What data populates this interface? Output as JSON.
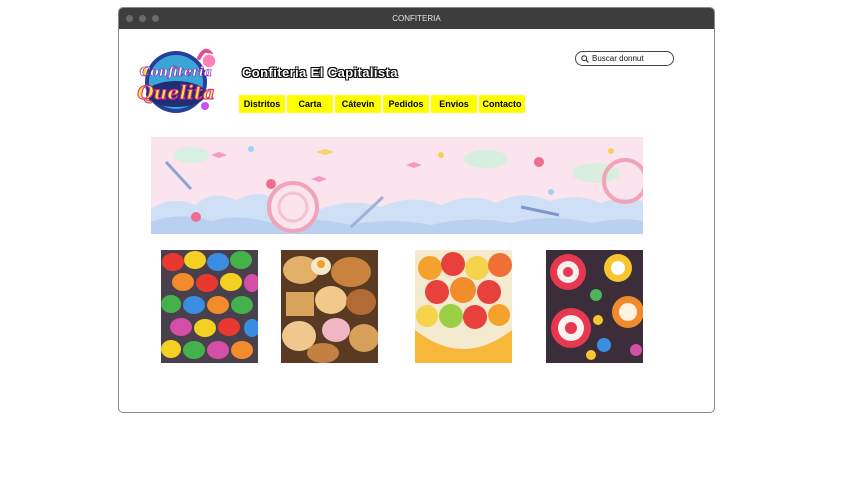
{
  "window": {
    "title": "CONFITERIA"
  },
  "logo": {
    "line1": "Confiteria",
    "line2": "Quelita"
  },
  "header": {
    "title": "Confiteria  El Capitalista"
  },
  "search": {
    "placeholder": "Buscar donnut"
  },
  "nav": {
    "items": [
      {
        "label": "Distritos"
      },
      {
        "label": "Carta"
      },
      {
        "label": "Cátevin"
      },
      {
        "label": "Pedidos"
      },
      {
        "label": "Envios"
      },
      {
        "label": "Contacto"
      }
    ]
  },
  "products": [
    {
      "image": "colorful-candy-buttons"
    },
    {
      "image": "assorted-pastries"
    },
    {
      "image": "gummy-candies-bowl"
    },
    {
      "image": "lollipops-and-candies"
    }
  ],
  "colors": {
    "nav_bg": "#ffff00",
    "titlebar": "#3d3d3d",
    "banner_bg": "#fbe4ee"
  }
}
